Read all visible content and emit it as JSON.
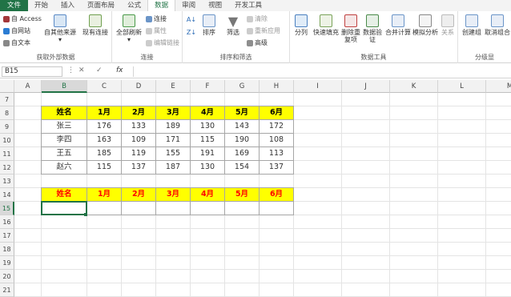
{
  "tabs": [
    "文件",
    "开始",
    "插入",
    "页面布局",
    "公式",
    "数据",
    "审阅",
    "视图",
    "开发工具"
  ],
  "active_tab": "数据",
  "ribbon": {
    "get_external": {
      "access": "自 Access",
      "web": "自网站",
      "text": "自文本",
      "other": "自其他来源",
      "existing": "现有连接",
      "label": "获取外部数据"
    },
    "connections": {
      "refresh": "全部刷新",
      "conn": "连接",
      "props": "属性",
      "edit_links": "编辑链接",
      "label": "连接"
    },
    "sort_filter": {
      "sort": "排序",
      "filter": "筛选",
      "clear": "清除",
      "reapply": "重新应用",
      "advanced": "高级",
      "label": "排序和筛选"
    },
    "data_tools": {
      "split": "分列",
      "flash": "快速填充",
      "remove_dup": "删除重复项",
      "validate": "数据验证",
      "merge": "合并计算",
      "whatif": "模拟分析",
      "relations": "关系",
      "label": "数据工具"
    },
    "outline": {
      "group": "创建组",
      "ungroup": "取消组合",
      "label": "分级显"
    }
  },
  "formula_bar": {
    "name_box": "B15",
    "fx": "fx",
    "value": ""
  },
  "columns": [
    "A",
    "B",
    "C",
    "D",
    "E",
    "F",
    "G",
    "H",
    "I",
    "J",
    "K",
    "L",
    "M"
  ],
  "rows": [
    "7",
    "8",
    "9",
    "10",
    "11",
    "12",
    "13",
    "14",
    "15",
    "16",
    "17",
    "18",
    "19",
    "20",
    "21"
  ],
  "table1": {
    "headers": [
      "姓名",
      "1月",
      "2月",
      "3月",
      "4月",
      "5月",
      "6月"
    ],
    "rows": [
      [
        "张三",
        "176",
        "133",
        "189",
        "130",
        "143",
        "172"
      ],
      [
        "李四",
        "163",
        "109",
        "171",
        "115",
        "190",
        "108"
      ],
      [
        "王五",
        "185",
        "119",
        "155",
        "191",
        "169",
        "113"
      ],
      [
        "赵六",
        "115",
        "137",
        "187",
        "130",
        "154",
        "137"
      ]
    ]
  },
  "table2": {
    "headers": [
      "姓名",
      "1月",
      "2月",
      "3月",
      "4月",
      "5月",
      "6月"
    ]
  },
  "colors": {
    "accent": "#217346",
    "header_fill": "#ffff00",
    "header2_text": "#ff0000"
  }
}
